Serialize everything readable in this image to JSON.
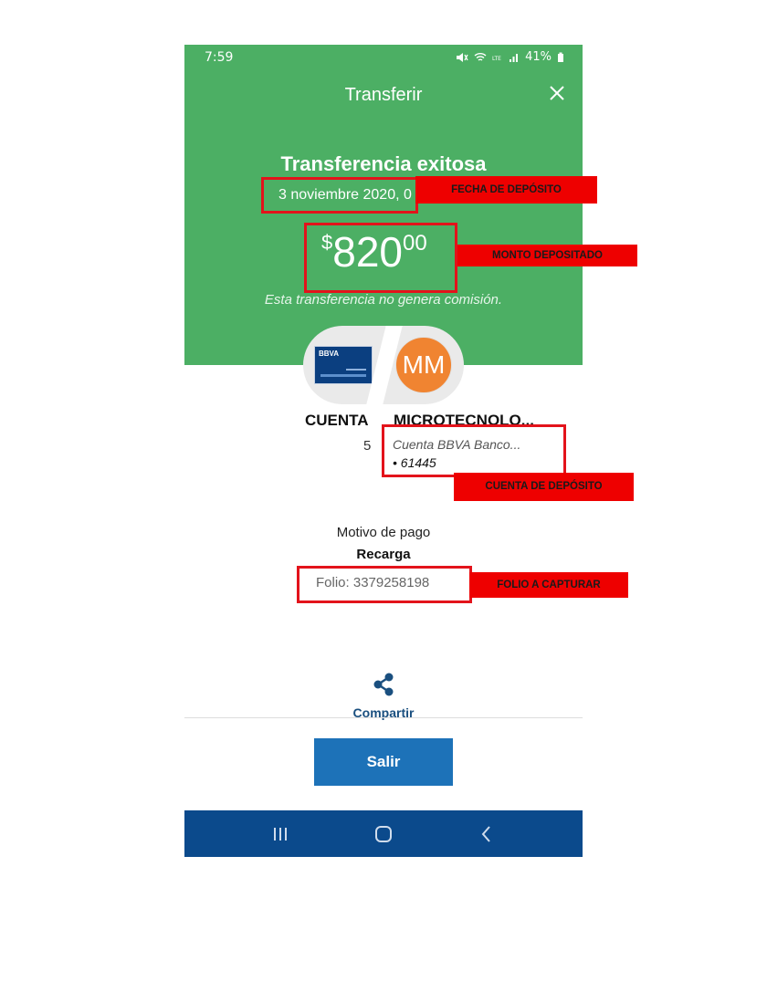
{
  "status_bar": {
    "time": "7:59",
    "battery": "41%"
  },
  "header": {
    "title": "Transferir",
    "close_icon": "close-icon"
  },
  "result": {
    "heading": "Transferencia exitosa",
    "date": "3 noviembre 2020, 0",
    "amount_currency": "$",
    "amount_integer": "820",
    "amount_cents": "00",
    "commission_note": "Esta transferencia no genera comisión."
  },
  "origin": {
    "card_brand": "BBVA",
    "label": "CUENTA",
    "number_fragment": "5"
  },
  "destination": {
    "avatar_initials": "MM",
    "name": "MICROTECNOLO...",
    "bank": "Cuenta BBVA Banco...",
    "account": "• 61445"
  },
  "payment": {
    "motivo_label": "Motivo de pago",
    "motivo_value": "Recarga",
    "folio": "Folio: 3379258198"
  },
  "actions": {
    "share_label": "Compartir",
    "exit_label": "Salir"
  },
  "annotations": {
    "fecha": "FECHA DE DEPÓSITO",
    "monto": "MONTO DEPOSITADO",
    "cuenta": "CUENTA DE DEPÓSITO",
    "folio": "FOLIO A CAPTURAR"
  },
  "colors": {
    "success_green": "#4caf64",
    "brand_blue": "#1d72b8",
    "nav_blue": "#0b4a8c",
    "annotation_red": "#ee0000"
  }
}
